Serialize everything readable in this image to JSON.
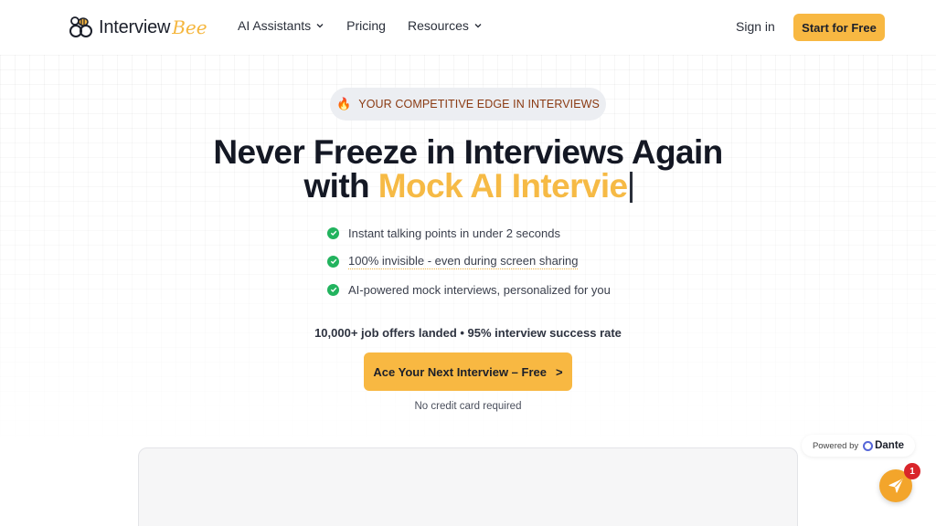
{
  "header": {
    "logo_text": "Interview",
    "logo_accent": "Bee",
    "nav": [
      {
        "label": "AI Assistants",
        "has_dropdown": true
      },
      {
        "label": "Pricing",
        "has_dropdown": false
      },
      {
        "label": "Resources",
        "has_dropdown": true
      }
    ],
    "sign_in": "Sign in",
    "start_free": "Start for Free"
  },
  "hero": {
    "badge_icon": "fire-icon",
    "badge": "YOUR COMPETITIVE EDGE IN INTERVIEWS",
    "headline_line1": "Never Freeze in Interviews Again",
    "headline_line2_prefix": "with",
    "headline_line2_accent": "Mock AI Intervie",
    "features": [
      "Instant talking points in under 2 seconds",
      "100% invisible - even during screen sharing",
      "AI-powered mock interviews, personalized for you"
    ],
    "stats": "10,000+ job offers landed • 95% interview success rate",
    "cta_label": "Ace Your Next Interview – Free",
    "cta_arrow": ">",
    "cta_note": "No credit card required"
  },
  "widget": {
    "powered_by": "Powered by",
    "brand": "Dante",
    "notification_count": "1"
  },
  "colors": {
    "accent": "#f8b842",
    "check_green": "#22b35e",
    "badge_text": "#8a3a12",
    "notification_red": "#d9252a"
  }
}
